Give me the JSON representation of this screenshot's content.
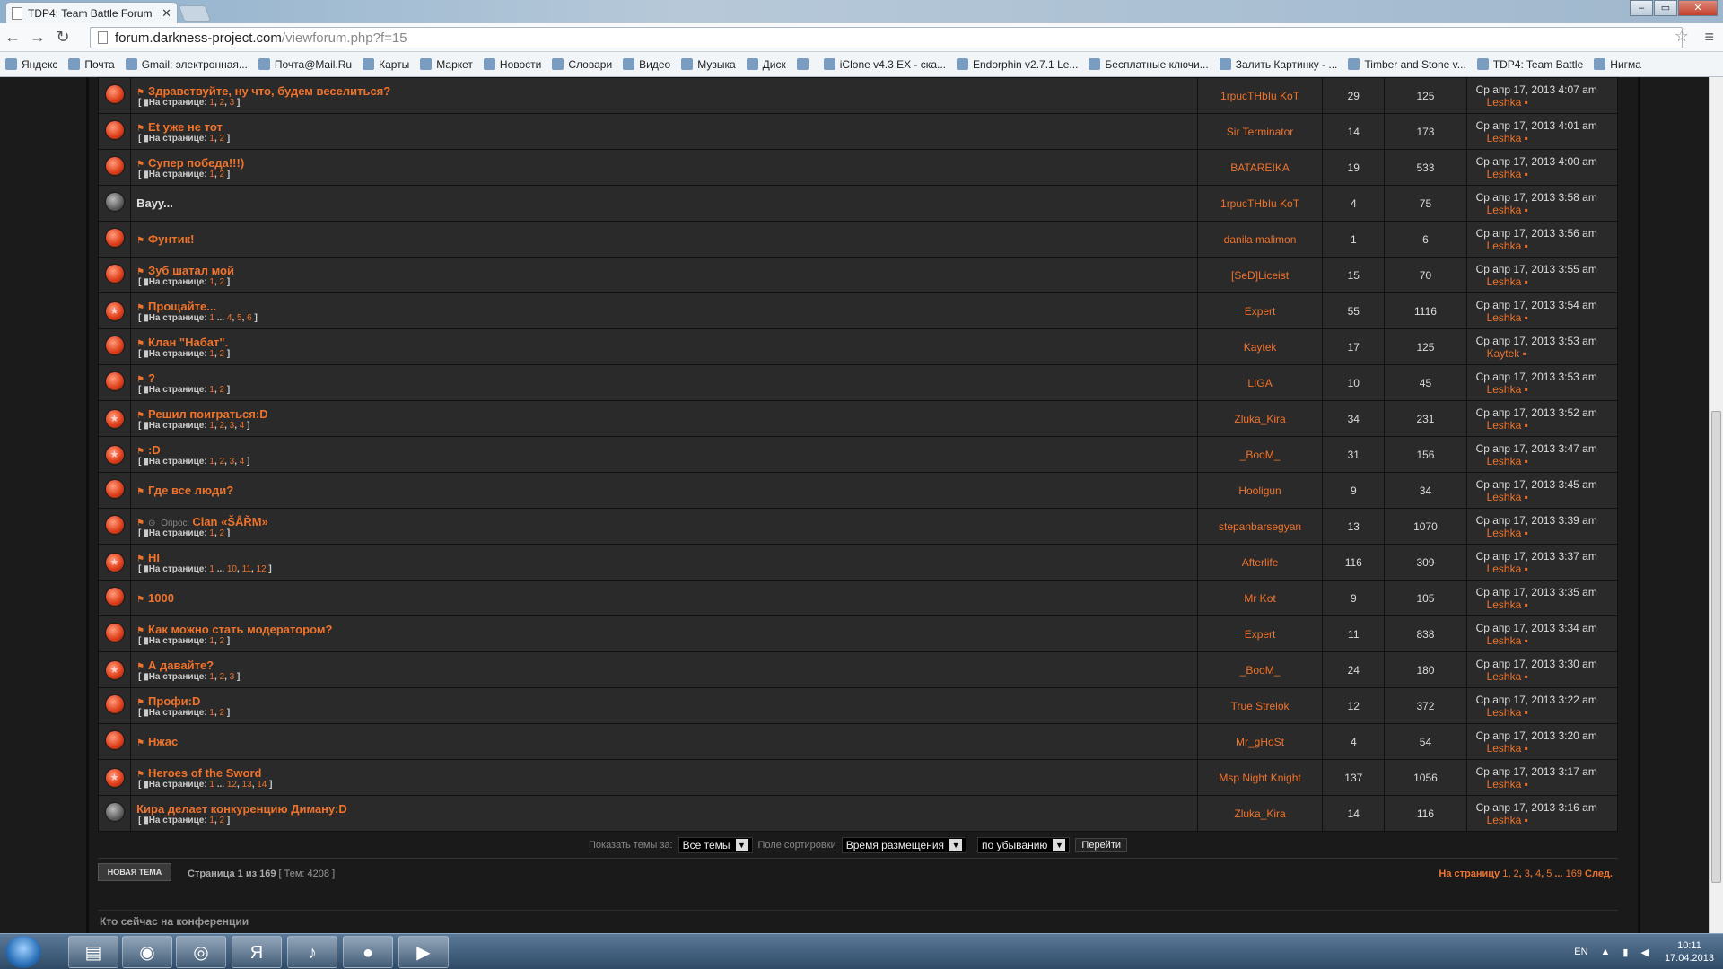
{
  "browser": {
    "tab_title": "TDP4: Team Battle Forum",
    "url_host": "forum.darkness-project.com",
    "url_path": "/viewforum.php?f=15",
    "bookmarks": [
      "Яндекс",
      "Почта",
      "Gmail: электронная...",
      "Почта@Mail.Ru",
      "Карты",
      "Маркет",
      "Новости",
      "Словари",
      "Видео",
      "Музыка",
      "Диск",
      "",
      "iClone v4.3 EX - ска...",
      "Endorphin v2.7.1 Le...",
      "Бесплатные ключи...",
      "Залить Картинку - ...",
      "Timber and Stone v...",
      "TDP4: Team Battle",
      "Нигма"
    ]
  },
  "topics_label": "На странице:",
  "topics": [
    {
      "title": "Здравствуйте, ну что, будем веселиться?",
      "pages": [
        "1",
        "2",
        "3"
      ],
      "author": "1rpucTHbIu KoT",
      "replies": "29",
      "views": "125",
      "last_date": "Ср апр 17, 2013 4:07 am",
      "last_by": "Leshka",
      "icon": "normal",
      "flag": true
    },
    {
      "title": "Et уже не тот",
      "pages": [
        "1",
        "2"
      ],
      "author": "Sir Terminator",
      "replies": "14",
      "views": "173",
      "last_date": "Ср апр 17, 2013 4:01 am",
      "last_by": "Leshka",
      "icon": "normal",
      "flag": true
    },
    {
      "title": "Супер победа!!!)",
      "pages": [
        "1",
        "2"
      ],
      "author": "BATAREIKA",
      "replies": "19",
      "views": "533",
      "last_date": "Ср апр 17, 2013 4:00 am",
      "last_by": "Leshka",
      "icon": "normal",
      "flag": true
    },
    {
      "title": "Вауу...",
      "pages": [],
      "author": "1rpucTHbIu KoT",
      "replies": "4",
      "views": "75",
      "last_date": "Ср апр 17, 2013 3:58 am",
      "last_by": "Leshka",
      "icon": "grey",
      "flag": false,
      "plain": true
    },
    {
      "title": "Фунтик!",
      "pages": [],
      "author": "danila malimon",
      "replies": "1",
      "views": "6",
      "last_date": "Ср апр 17, 2013 3:56 am",
      "last_by": "Leshka",
      "icon": "normal",
      "flag": true
    },
    {
      "title": "Зуб шатал мой",
      "pages": [
        "1",
        "2"
      ],
      "author": "[SeD]Liceist",
      "replies": "15",
      "views": "70",
      "last_date": "Ср апр 17, 2013 3:55 am",
      "last_by": "Leshka",
      "icon": "normal",
      "flag": true
    },
    {
      "title": "Прощайте...",
      "pages": [
        "1",
        "...",
        "4",
        "5",
        "6"
      ],
      "author": "Expert",
      "replies": "55",
      "views": "1116",
      "last_date": "Ср апр 17, 2013 3:54 am",
      "last_by": "Leshka",
      "icon": "hot",
      "flag": true
    },
    {
      "title": "Клан \"Набат\".",
      "pages": [
        "1",
        "2"
      ],
      "author": "Kaytek",
      "replies": "17",
      "views": "125",
      "last_date": "Ср апр 17, 2013 3:53 am",
      "last_by": "Kaytek",
      "icon": "normal",
      "flag": true
    },
    {
      "title": "?",
      "pages": [
        "1",
        "2"
      ],
      "author": "LIGA",
      "replies": "10",
      "views": "45",
      "last_date": "Ср апр 17, 2013 3:53 am",
      "last_by": "Leshka",
      "icon": "normal",
      "flag": true
    },
    {
      "title": "Решил поиграться:D",
      "pages": [
        "1",
        "2",
        "3",
        "4"
      ],
      "author": "Zluka_Kira",
      "replies": "34",
      "views": "231",
      "last_date": "Ср апр 17, 2013 3:52 am",
      "last_by": "Leshka",
      "icon": "hot",
      "flag": true
    },
    {
      "title": ":D",
      "pages": [
        "1",
        "2",
        "3",
        "4"
      ],
      "author": "_BooM_",
      "replies": "31",
      "views": "156",
      "last_date": "Ср апр 17, 2013 3:47 am",
      "last_by": "Leshka",
      "icon": "hot",
      "flag": true
    },
    {
      "title": "Где все люди?",
      "pages": [],
      "author": "Hooligun",
      "replies": "9",
      "views": "34",
      "last_date": "Ср апр 17, 2013 3:45 am",
      "last_by": "Leshka",
      "icon": "normal",
      "flag": true
    },
    {
      "title": "Clan «ŠÅŘM»",
      "pages": [
        "1",
        "2"
      ],
      "author": "stepanbarsegyan",
      "replies": "13",
      "views": "1070",
      "last_date": "Ср апр 17, 2013 3:39 am",
      "last_by": "Leshka",
      "icon": "normal",
      "flag": true,
      "poll": "Опрос:"
    },
    {
      "title": "HI",
      "pages": [
        "1",
        "...",
        "10",
        "11",
        "12"
      ],
      "author": "Afterlife",
      "replies": "116",
      "views": "309",
      "last_date": "Ср апр 17, 2013 3:37 am",
      "last_by": "Leshka",
      "icon": "hot",
      "flag": true
    },
    {
      "title": "1000",
      "pages": [],
      "author": "Mr Kot",
      "replies": "9",
      "views": "105",
      "last_date": "Ср апр 17, 2013 3:35 am",
      "last_by": "Leshka",
      "icon": "normal",
      "flag": true
    },
    {
      "title": "Как можно стать модератором?",
      "pages": [
        "1",
        "2"
      ],
      "author": "Expert",
      "replies": "11",
      "views": "838",
      "last_date": "Ср апр 17, 2013 3:34 am",
      "last_by": "Leshka",
      "icon": "normal",
      "flag": true
    },
    {
      "title": "А давайте?",
      "pages": [
        "1",
        "2",
        "3"
      ],
      "author": "_BooM_",
      "replies": "24",
      "views": "180",
      "last_date": "Ср апр 17, 2013 3:30 am",
      "last_by": "Leshka",
      "icon": "hot",
      "flag": true
    },
    {
      "title": "Профи:D",
      "pages": [
        "1",
        "2"
      ],
      "author": "True Strelok",
      "replies": "12",
      "views": "372",
      "last_date": "Ср апр 17, 2013 3:22 am",
      "last_by": "Leshka",
      "icon": "normal",
      "flag": true
    },
    {
      "title": "Нжас",
      "pages": [],
      "author": "Mr_gHoSt",
      "replies": "4",
      "views": "54",
      "last_date": "Ср апр 17, 2013 3:20 am",
      "last_by": "Leshka",
      "icon": "normal",
      "flag": true
    },
    {
      "title": "Heroes of the Sword",
      "pages": [
        "1",
        "...",
        "12",
        "13",
        "14"
      ],
      "author": "Msp Night Knight",
      "replies": "137",
      "views": "1056",
      "last_date": "Ср апр 17, 2013 3:17 am",
      "last_by": "Leshka",
      "icon": "hot",
      "flag": true
    },
    {
      "title": "Кира делает конкуренцию Диману:D",
      "pages": [
        "1",
        "2"
      ],
      "author": "Zluka_Kira",
      "replies": "14",
      "views": "116",
      "last_date": "Ср апр 17, 2013 3:16 am",
      "last_by": "Leshka",
      "icon": "grey",
      "flag": false,
      "plain2": true
    }
  ],
  "sortbar": {
    "show_label": "Показать темы за:",
    "show_value": "Все темы",
    "sort_label": "Поле сортировки",
    "sort_value": "Время размещения",
    "order_value": "по убыванию",
    "go_label": "Перейти"
  },
  "footer": {
    "new_topic": "НОВАЯ ТЕМА",
    "page_stat": "Страница 1 из 169",
    "topics_count": "[ Тем: 4208 ]",
    "pagenav_label": "На страницу",
    "pagenav_pages": [
      "1",
      "2",
      "3",
      "4",
      "5",
      "...",
      "169"
    ],
    "next": "След.",
    "who_online": "Кто сейчас на конференции"
  },
  "taskbar": {
    "lang": "EN",
    "time": "10:11",
    "date": "17.04.2013"
  },
  "colors": {
    "accent": "#f0732c",
    "bg": "#1a1a1a",
    "row": "#2a2a2a"
  }
}
